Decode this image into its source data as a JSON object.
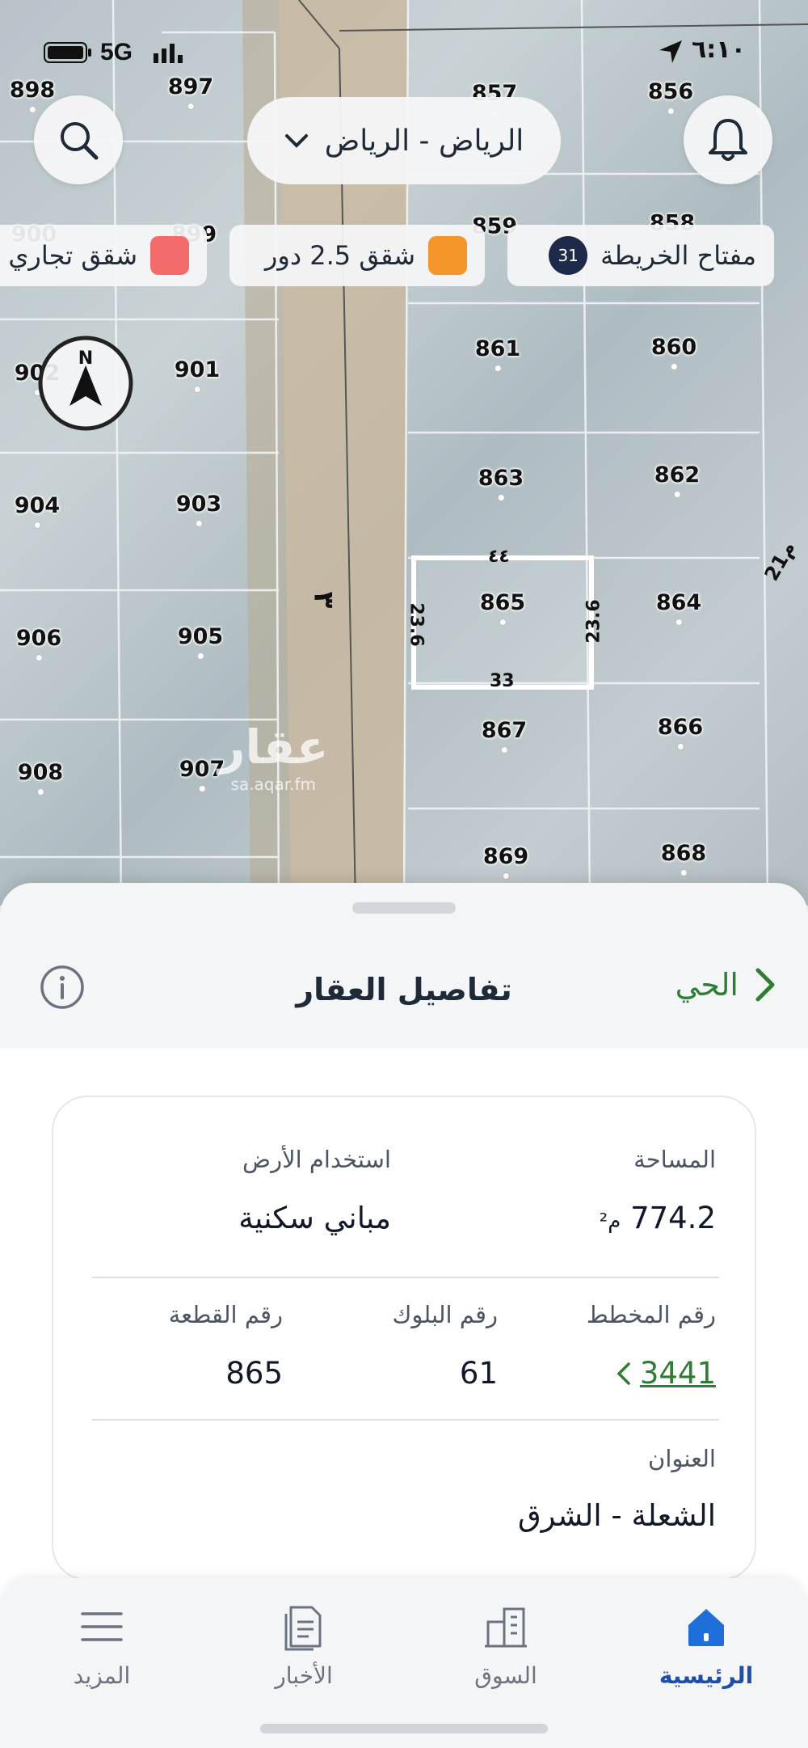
{
  "status_bar": {
    "time": "٦:١٠",
    "network": "5G"
  },
  "map": {
    "city_selector": "الرياض - الرياض",
    "legend": [
      {
        "label": "مفتاح الخريطة",
        "badge": "31"
      },
      {
        "label": "شقق 2.5 دور",
        "color": "#f5952a"
      },
      {
        "label": "شقق تجاري",
        "color": "#f36b6b"
      }
    ],
    "street_label": "٣",
    "side_label": "21م",
    "selected_lot": {
      "top": "٤٤",
      "left": "23.6",
      "right": "23.6",
      "bottom": "33"
    },
    "lots": [
      {
        "num": "898"
      },
      {
        "num": "897"
      },
      {
        "num": "857"
      },
      {
        "num": "856"
      },
      {
        "num": "900"
      },
      {
        "num": "899"
      },
      {
        "num": "859"
      },
      {
        "num": "858"
      },
      {
        "num": "902"
      },
      {
        "num": "901"
      },
      {
        "num": "861"
      },
      {
        "num": "860"
      },
      {
        "num": "904"
      },
      {
        "num": "903"
      },
      {
        "num": "863"
      },
      {
        "num": "862"
      },
      {
        "num": "906"
      },
      {
        "num": "905"
      },
      {
        "num": "865"
      },
      {
        "num": "864"
      },
      {
        "num": "908"
      },
      {
        "num": "907"
      },
      {
        "num": "867"
      },
      {
        "num": "866"
      },
      {
        "num": "869"
      },
      {
        "num": "868"
      }
    ],
    "compass_label": "N",
    "watermark": {
      "logo": "عقار",
      "url": "sa.aqar.fm"
    }
  },
  "sheet": {
    "title": "تفاصيل العقار",
    "neighborhood_link": "الحي",
    "area_label": "المساحة",
    "area_value": "774.2",
    "area_unit": "م²",
    "land_use_label": "استخدام الأرض",
    "land_use_value": "مباني سكنية",
    "plan_label": "رقم المخطط",
    "plan_value": "3441",
    "block_label": "رقم البلوك",
    "block_value": "61",
    "plot_label": "رقم القطعة",
    "plot_value": "865",
    "address_label": "العنوان",
    "address_value": "الشعلة - الشرق"
  },
  "tabs": [
    {
      "label": "الرئيسية",
      "icon": "home-icon",
      "active": true
    },
    {
      "label": "السوق",
      "icon": "buildings-icon",
      "active": false
    },
    {
      "label": "الأخبار",
      "icon": "news-icon",
      "active": false
    },
    {
      "label": "المزيد",
      "icon": "menu-icon",
      "active": false
    }
  ],
  "colors": {
    "accent_green": "#2e7d32",
    "accent_blue": "#1e4fa8"
  }
}
